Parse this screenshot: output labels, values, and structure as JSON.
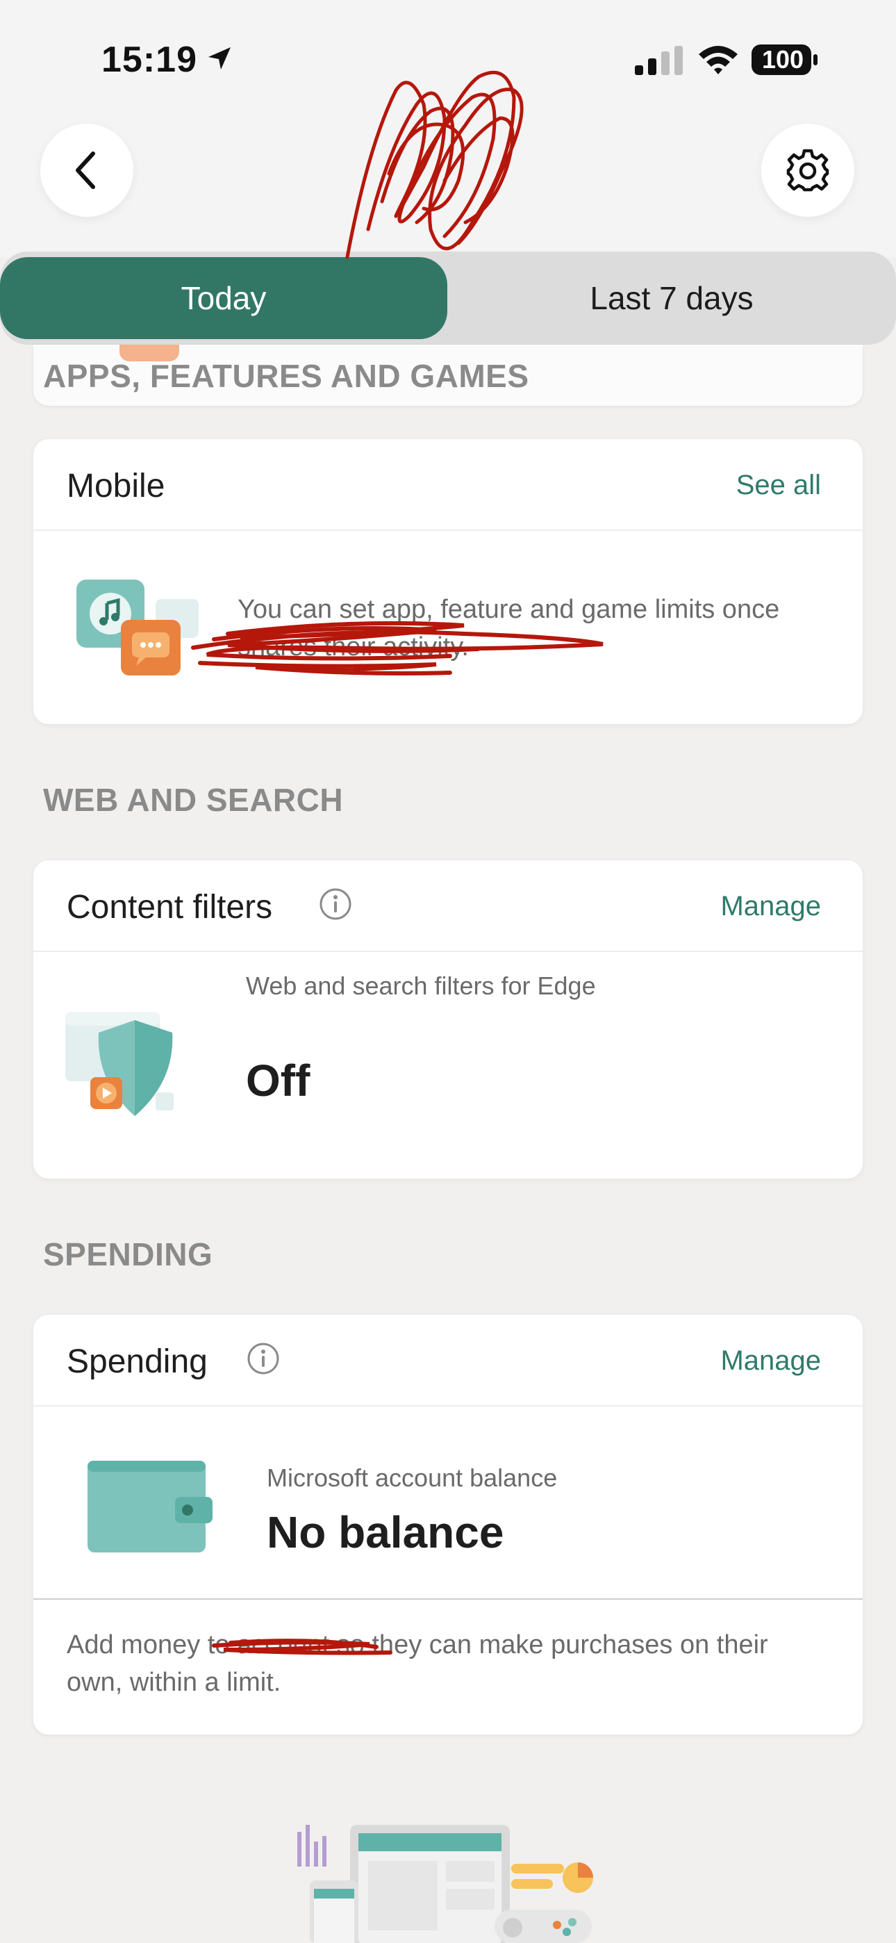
{
  "status_bar": {
    "time": "15:19",
    "battery": "100",
    "icons": [
      "location-arrow-icon",
      "signal-icon",
      "wifi-icon",
      "battery-icon"
    ]
  },
  "header": {
    "back_icon": "chevron-left-icon",
    "settings_icon": "gear-icon"
  },
  "tabs": [
    {
      "label": "Today",
      "active": true
    },
    {
      "label": "Last 7 days",
      "active": false
    }
  ],
  "sections": {
    "apps": {
      "title": "APPS, FEATURES AND GAMES"
    },
    "web": {
      "title": "WEB AND SEARCH"
    },
    "spending": {
      "title": "SPENDING"
    }
  },
  "mobile_card": {
    "title": "Mobile",
    "action": "See all",
    "message": "You can set app, feature and game limits once                          shares their activity."
  },
  "content_filters_card": {
    "title": "Content filters",
    "action": "Manage",
    "subtitle": "Web and search filters for Edge",
    "value": "Off"
  },
  "spending_card": {
    "title": "Spending",
    "action": "Manage",
    "subtitle": "Microsoft account balance",
    "value": "No balance",
    "note": "Add money to                account so they can make purchases on their own, within a limit."
  },
  "colors": {
    "accent": "#327766",
    "link": "#2f7a68",
    "background": "#f1f0ef",
    "redaction": "#b5170b"
  }
}
